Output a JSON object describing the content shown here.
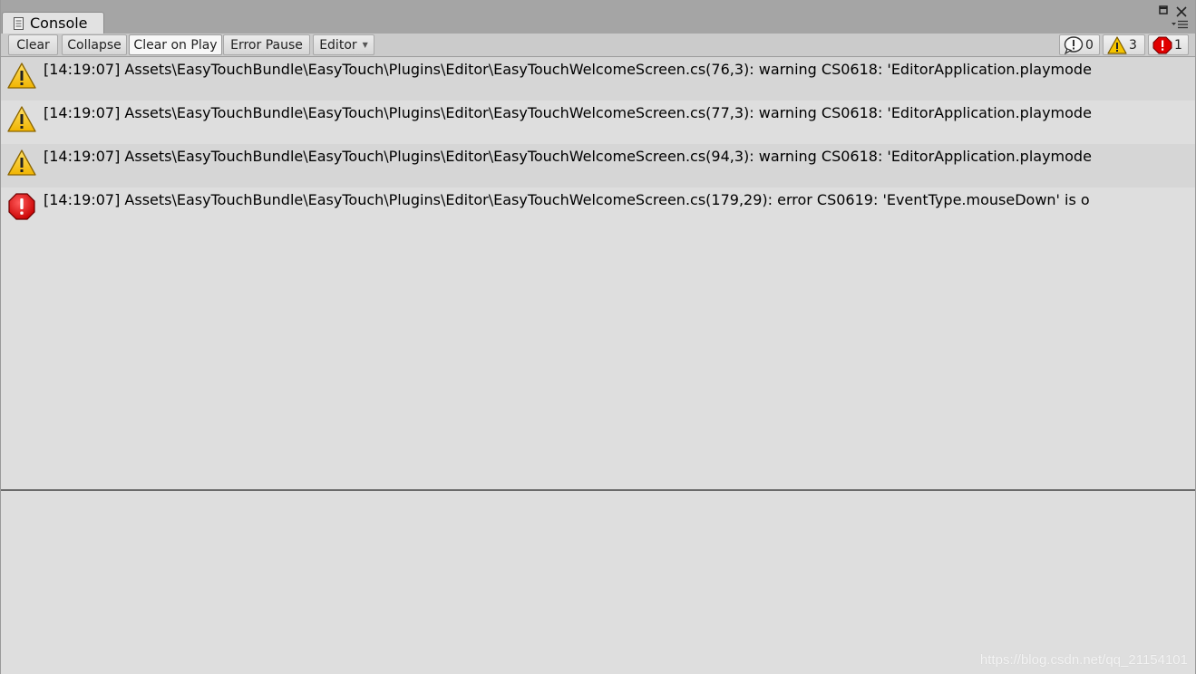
{
  "window": {
    "tab_title": "Console",
    "tab_icon": "console-page-icon"
  },
  "toolbar": {
    "clear_label": "Clear",
    "collapse_label": "Collapse",
    "clear_on_play_label": "Clear on Play",
    "error_pause_label": "Error Pause",
    "editor_label": "Editor",
    "editor_caret": "▼"
  },
  "counters": {
    "info_count": "0",
    "warning_count": "3",
    "error_count": "1"
  },
  "log_entries": [
    {
      "type": "warning",
      "icon": "warning-icon",
      "text": "[14:19:07] Assets\\EasyTouchBundle\\EasyTouch\\Plugins\\Editor\\EasyTouchWelcomeScreen.cs(76,3): warning CS0618: 'EditorApplication.playmode"
    },
    {
      "type": "warning",
      "icon": "warning-icon",
      "text": "[14:19:07] Assets\\EasyTouchBundle\\EasyTouch\\Plugins\\Editor\\EasyTouchWelcomeScreen.cs(77,3): warning CS0618: 'EditorApplication.playmode"
    },
    {
      "type": "warning",
      "icon": "warning-icon",
      "text": "[14:19:07] Assets\\EasyTouchBundle\\EasyTouch\\Plugins\\Editor\\EasyTouchWelcomeScreen.cs(94,3): warning CS0618: 'EditorApplication.playmode"
    },
    {
      "type": "error",
      "icon": "error-icon",
      "text": "[14:19:07] Assets\\EasyTouchBundle\\EasyTouch\\Plugins\\Editor\\EasyTouchWelcomeScreen.cs(179,29): error CS0619: 'EventType.mouseDown' is o"
    }
  ],
  "watermark": "https://blog.csdn.net/qq_21154101",
  "colors": {
    "warning_fill": "#f5c400",
    "error_fill": "#e00000",
    "panel_bg": "#dedede",
    "tabbar_bg": "#a5a5a5"
  }
}
